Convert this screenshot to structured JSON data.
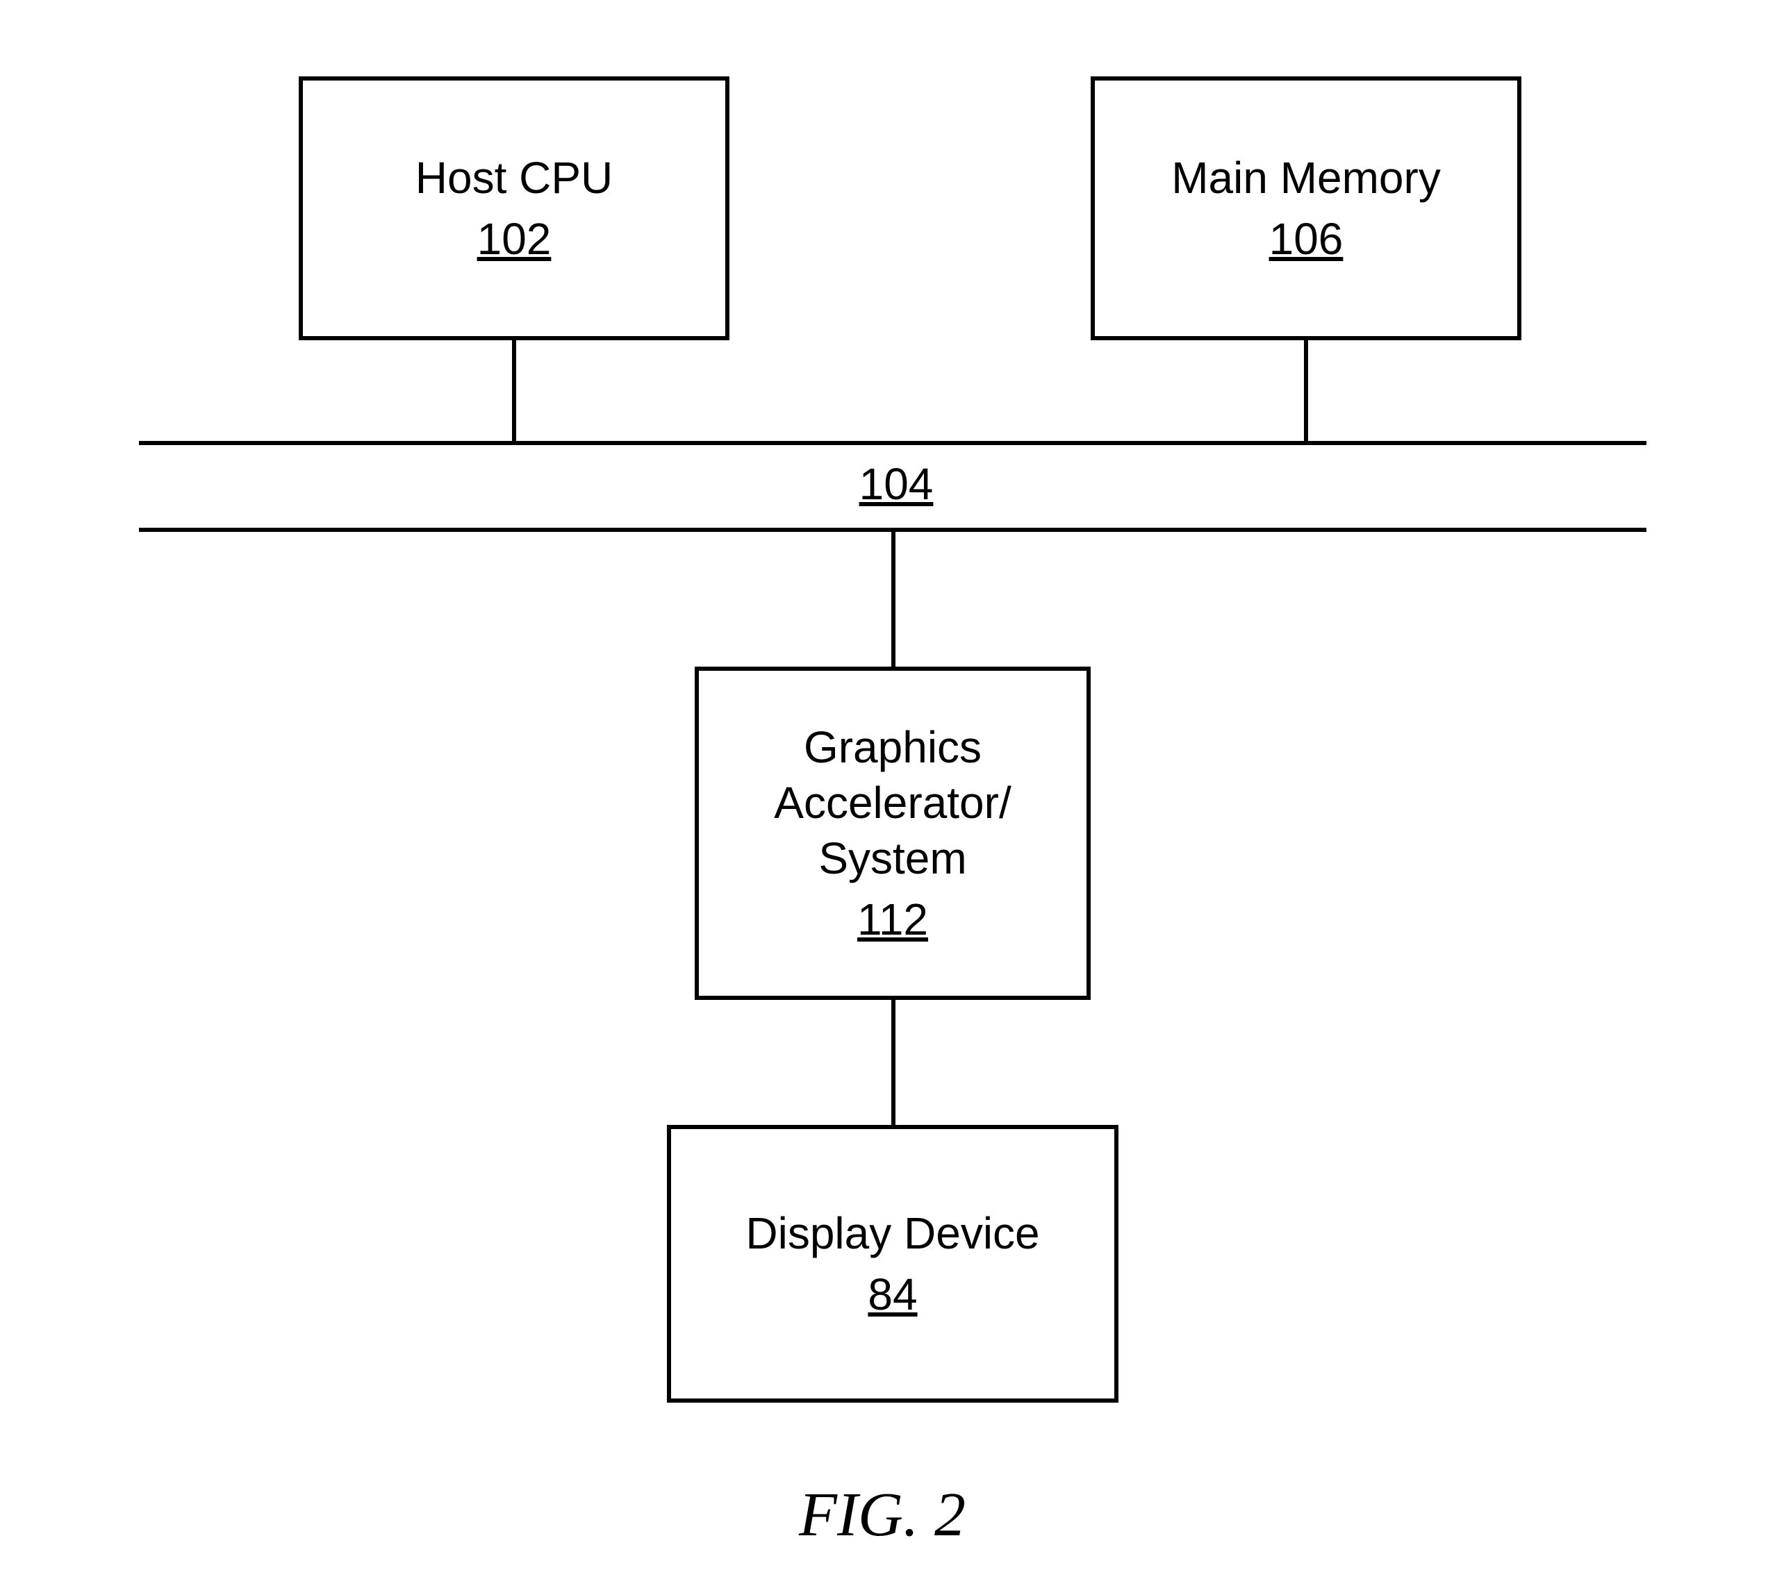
{
  "blocks": {
    "host_cpu": {
      "label": "Host CPU",
      "ref": "102"
    },
    "main_memory": {
      "label": "Main Memory",
      "ref": "106"
    },
    "bus": {
      "ref": "104"
    },
    "graphics": {
      "label": "Graphics\nAccelerator/\nSystem",
      "ref": "112"
    },
    "display": {
      "label": "Display Device",
      "ref": "84"
    }
  },
  "figure_caption": "FIG. 2"
}
